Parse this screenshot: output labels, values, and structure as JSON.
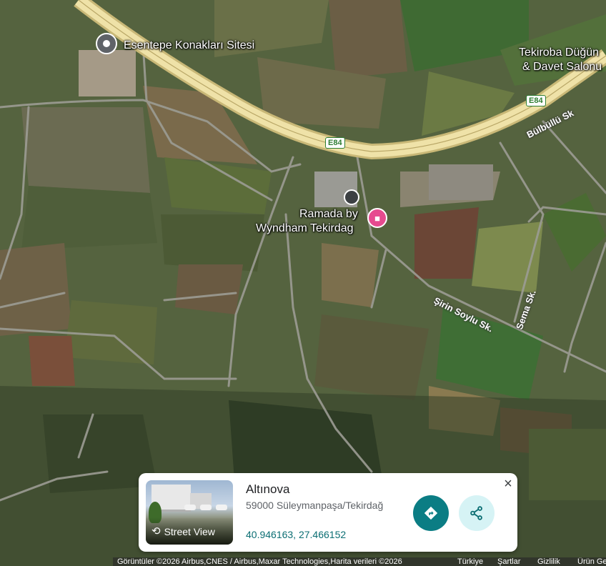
{
  "map": {
    "places": {
      "esentepe": "Esentepe Konakları Sitesi",
      "tekiroba_line1": "Tekiroba Düğün",
      "tekiroba_line2": "& Davet Salonu",
      "ramada_line1": "Ramada by",
      "ramada_line2": "Wyndham Tekirdag"
    },
    "roads": {
      "e84_a": "E84",
      "e84_b": "E84",
      "bulbullu": "Bülbüllü Sk",
      "sirin_soylu": "Şirin Soylu Sk.",
      "sema": "Sema Sk."
    },
    "icons": {
      "place_pin": "map-pin-icon",
      "hotel": "hotel-bed-icon"
    },
    "colors": {
      "highway": "#e8d79a",
      "hotel_pin": "#e64a8f",
      "directions": "#0b7d84",
      "share_bg": "#d6f3f5"
    }
  },
  "card": {
    "title": "Altınova",
    "address": "59000 Süleymanpaşa/Tekirdağ",
    "coordinates": "40.946163, 27.466152",
    "street_view_label": "Street View",
    "close_symbol": "×"
  },
  "footer": {
    "attribution": "Görüntüler ©2026 Airbus,CNES / Airbus,Maxar Technologies,Harita verileri ©2026",
    "country": "Türkiye",
    "terms": "Şartlar",
    "privacy": "Gizlilik",
    "feedback": "Ürün Geri"
  }
}
